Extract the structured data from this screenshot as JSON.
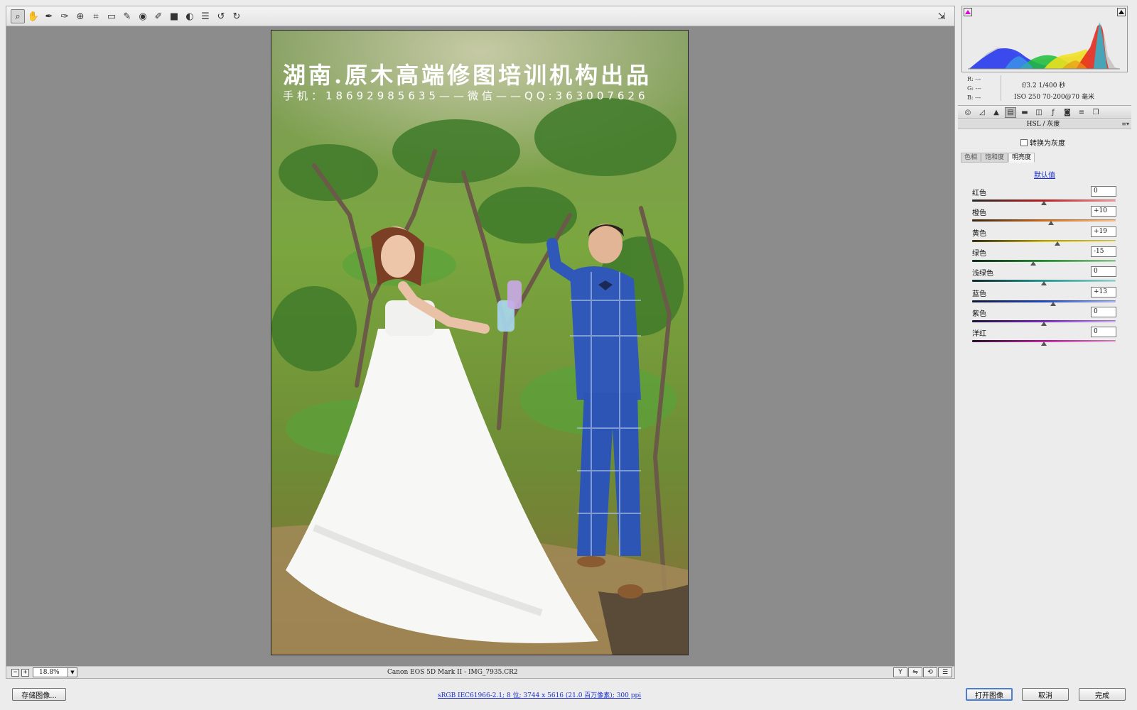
{
  "toolbar": {
    "tools": [
      {
        "name": "zoom-tool",
        "icon": "magnifier-icon",
        "glyph": "⌕"
      },
      {
        "name": "hand-tool",
        "icon": "hand-icon",
        "glyph": "✋"
      },
      {
        "name": "white-balance-tool",
        "icon": "eyedropper-icon",
        "glyph": "✒"
      },
      {
        "name": "color-sampler-tool",
        "icon": "color-sampler-icon",
        "glyph": "✑"
      },
      {
        "name": "targeted-adjustment-tool",
        "icon": "target-adjust-icon",
        "glyph": "⊕"
      },
      {
        "name": "crop-tool",
        "icon": "crop-icon",
        "glyph": "⌗"
      },
      {
        "name": "straighten-tool",
        "icon": "straighten-icon",
        "glyph": "▭"
      },
      {
        "name": "spot-removal-tool",
        "icon": "spot-removal-icon",
        "glyph": "✎"
      },
      {
        "name": "red-eye-tool",
        "icon": "red-eye-icon",
        "glyph": "◉"
      },
      {
        "name": "adjustment-brush-tool",
        "icon": "brush-icon",
        "glyph": "✐"
      },
      {
        "name": "graduated-filter-tool",
        "icon": "graduated-filter-icon",
        "glyph": "■"
      },
      {
        "name": "radial-filter-tool",
        "icon": "radial-filter-icon",
        "glyph": "◐"
      },
      {
        "name": "preferences-tool",
        "icon": "list-icon",
        "glyph": "☰"
      },
      {
        "name": "rotate-left-tool",
        "icon": "rotate-ccw-icon",
        "glyph": "↺"
      },
      {
        "name": "rotate-right-tool",
        "icon": "rotate-cw-icon",
        "glyph": "↻"
      }
    ],
    "export_icon": "fullscreen-toggle-icon",
    "export_glyph": "⇲"
  },
  "photo": {
    "watermark_title": "湖南.原木高端修图培训机构出品",
    "watermark_contact": "手机：18692985635——微信——QQ:363007626"
  },
  "status": {
    "zoom_out": "−",
    "zoom_in": "+",
    "zoom": "18.8%",
    "zoom_dropdown": "▼",
    "camera_info": "Canon EOS 5D Mark II -  IMG_7935.CR2",
    "view_buttons": [
      "Y",
      "⇋",
      "⟲",
      "☰"
    ]
  },
  "bottom": {
    "save_label": "存储图像...",
    "workflow": "sRGB IEC61966-2.1; 8 位; 3744 x 5616 (21.0 百万像素); 300 ppi",
    "open_label": "打开图像",
    "cancel_label": "取消",
    "done_label": "完成"
  },
  "info": {
    "r": "R:  ---",
    "g": "G:  ---",
    "b": "B:  ---",
    "aperture_shutter": "f/3.2   1/400 秒",
    "iso_lens": "ISO 250   70-200@70 毫米"
  },
  "panel": {
    "tabs": [
      {
        "icon": "basic-icon",
        "glyph": "◎"
      },
      {
        "icon": "tone-curve-icon",
        "glyph": "◿"
      },
      {
        "icon": "detail-icon",
        "glyph": "▲"
      },
      {
        "icon": "hsl-icon",
        "glyph": "▤"
      },
      {
        "icon": "split-toning-icon",
        "glyph": "▬"
      },
      {
        "icon": "lens-corrections-icon",
        "glyph": "◫"
      },
      {
        "icon": "effects-icon",
        "glyph": "ƒ"
      },
      {
        "icon": "camera-calibration-icon",
        "glyph": "◙"
      },
      {
        "icon": "presets-icon",
        "glyph": "≡"
      },
      {
        "icon": "snapshots-icon",
        "glyph": "❐"
      }
    ],
    "active_tab_index": 3,
    "title": "HSL / 灰度",
    "menu_glyph": "≡▾",
    "grayscale_label": "转换为灰度",
    "subtabs": [
      "色相",
      "饱和度",
      "明亮度"
    ],
    "active_subtab": 2,
    "default_label": "默认值",
    "sliders": [
      {
        "label": "红色",
        "value": "0",
        "level": 0,
        "gradient": [
          "#2a2a2a",
          "#c21f1f",
          "#f0a0a0"
        ]
      },
      {
        "label": "橙色",
        "value": "+10",
        "level": 10,
        "gradient": [
          "#3a2410",
          "#d26c1a",
          "#f5c08a"
        ]
      },
      {
        "label": "黄色",
        "value": "+19",
        "level": 19,
        "gradient": [
          "#3a3510",
          "#d8c21a",
          "#f6eb9c"
        ]
      },
      {
        "label": "绿色",
        "value": "-15",
        "level": -15,
        "gradient": [
          "#10301a",
          "#2f9e3a",
          "#a8e0a8"
        ]
      },
      {
        "label": "浅绿色",
        "value": "0",
        "level": 0,
        "gradient": [
          "#103030",
          "#25a8a0",
          "#a6e6e0"
        ]
      },
      {
        "label": "蓝色",
        "value": "+13",
        "level": 13,
        "gradient": [
          "#101838",
          "#2048c8",
          "#a8b8f0"
        ]
      },
      {
        "label": "紫色",
        "value": "0",
        "level": 0,
        "gradient": [
          "#201038",
          "#7a2ac8",
          "#d0b0f0"
        ]
      },
      {
        "label": "洋红",
        "value": "0",
        "level": 0,
        "gradient": [
          "#301030",
          "#c82aa8",
          "#f0b0e0"
        ]
      }
    ]
  }
}
